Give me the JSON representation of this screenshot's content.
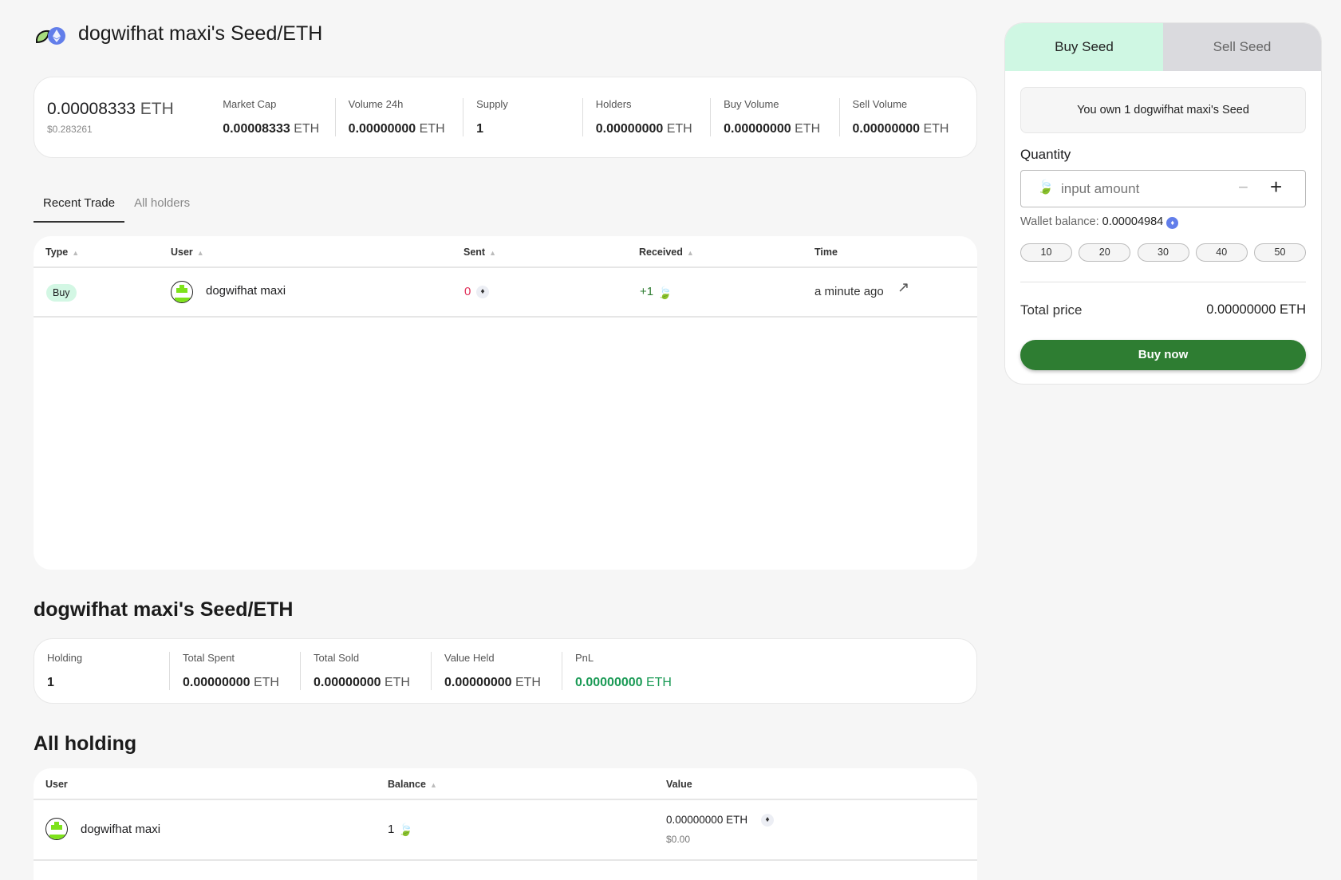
{
  "header": {
    "title": "dogwifhat maxi's Seed/ETH"
  },
  "stats": {
    "price": "0.00008333",
    "price_unit": "ETH",
    "price_usd": "$0.283261",
    "items": [
      {
        "label": "Market Cap",
        "value": "0.00008333",
        "unit": "ETH"
      },
      {
        "label": "Volume 24h",
        "value": "0.00000000",
        "unit": "ETH"
      },
      {
        "label": "Supply",
        "value": "1",
        "unit": ""
      },
      {
        "label": "Holders",
        "value": "0.00000000",
        "unit": "ETH"
      },
      {
        "label": "Buy Volume",
        "value": "0.00000000",
        "unit": "ETH"
      },
      {
        "label": "Sell Volume",
        "value": "0.00000000",
        "unit": "ETH"
      }
    ]
  },
  "tabs": [
    {
      "label": "Recent Trade"
    },
    {
      "label": "All holders"
    }
  ],
  "trades": {
    "headers": {
      "type": "Type",
      "user": "User",
      "sent": "Sent",
      "received": "Received",
      "time": "Time"
    },
    "rows": [
      {
        "type": "Buy",
        "user": "dogwifhat maxi",
        "sent": "0",
        "received": "+1",
        "time": "a minute ago"
      }
    ]
  },
  "holding": {
    "title": "dogwifhat maxi's Seed/ETH",
    "items": [
      {
        "label": "Holding",
        "value": "1",
        "unit": ""
      },
      {
        "label": "Total Spent",
        "value": "0.00000000",
        "unit": "ETH"
      },
      {
        "label": "Total Sold",
        "value": "0.00000000",
        "unit": "ETH"
      },
      {
        "label": "Value Held",
        "value": "0.00000000",
        "unit": "ETH"
      },
      {
        "label": "PnL",
        "value": "0.00000000",
        "unit": "ETH"
      }
    ]
  },
  "all_holding": {
    "title": "All holding",
    "headers": {
      "user": "User",
      "balance": "Balance",
      "value": "Value"
    },
    "rows": [
      {
        "user": "dogwifhat maxi",
        "balance": "1",
        "value": "0.00000000 ETH",
        "value_usd": "$0.00"
      }
    ]
  },
  "panel": {
    "buy_tab": "Buy Seed",
    "sell_tab": "Sell Seed",
    "own_text": "You own 1 dogwifhat maxi's Seed",
    "quantity_label": "Quantity",
    "input_placeholder": "input amount",
    "minus": "−",
    "plus": "+",
    "wallet_label": "Wallet balance:",
    "wallet_value": "0.00004984",
    "quick": [
      "10",
      "20",
      "30",
      "40",
      "50"
    ],
    "total_label": "Total price",
    "total_value": "0.00000000 ETH",
    "buy_button": "Buy now"
  },
  "colors": {
    "accent": "#2e7d32",
    "tab_active": "#cff7e3",
    "pnl": "#1a9a55",
    "sent": "#e0315a"
  }
}
